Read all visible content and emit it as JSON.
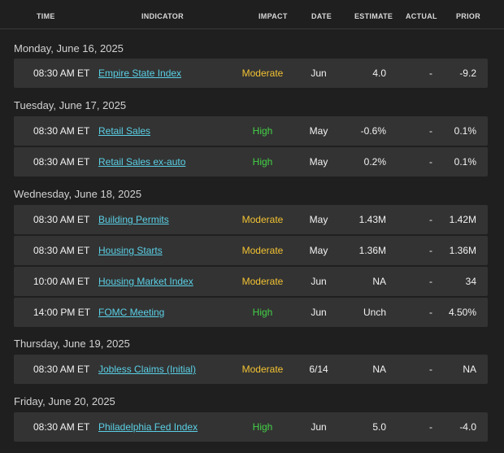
{
  "header": {
    "time": "TIME",
    "indicator": "INDICATOR",
    "impact": "IMPACT",
    "date": "DATE",
    "estimate": "ESTIMATE",
    "actual": "ACTUAL",
    "prior": "PRIOR"
  },
  "days": [
    {
      "label": "Monday, June 16, 2025",
      "rows": [
        {
          "time": "08:30 AM ET",
          "indicator": "Empire State Index",
          "impact": "Moderate",
          "date": "Jun",
          "estimate": "4.0",
          "actual": "-",
          "prior": "-9.2"
        }
      ]
    },
    {
      "label": "Tuesday, June 17, 2025",
      "rows": [
        {
          "time": "08:30 AM ET",
          "indicator": "Retail Sales",
          "impact": "High",
          "date": "May",
          "estimate": "-0.6%",
          "actual": "-",
          "prior": "0.1%"
        },
        {
          "time": "08:30 AM ET",
          "indicator": "Retail Sales ex-auto",
          "impact": "High",
          "date": "May",
          "estimate": "0.2%",
          "actual": "-",
          "prior": "0.1%"
        }
      ]
    },
    {
      "label": "Wednesday, June 18, 2025",
      "rows": [
        {
          "time": "08:30 AM ET",
          "indicator": "Building Permits",
          "impact": "Moderate",
          "date": "May",
          "estimate": "1.43M",
          "actual": "-",
          "prior": "1.42M"
        },
        {
          "time": "08:30 AM ET",
          "indicator": "Housing Starts",
          "impact": "Moderate",
          "date": "May",
          "estimate": "1.36M",
          "actual": "-",
          "prior": "1.36M"
        },
        {
          "time": "10:00 AM ET",
          "indicator": "Housing Market Index",
          "impact": "Moderate",
          "date": "Jun",
          "estimate": "NA",
          "actual": "-",
          "prior": "34"
        },
        {
          "time": "14:00 PM ET",
          "indicator": "FOMC Meeting",
          "impact": "High",
          "date": "Jun",
          "estimate": "Unch",
          "actual": "-",
          "prior": "4.50%"
        }
      ]
    },
    {
      "label": "Thursday, June 19, 2025",
      "rows": [
        {
          "time": "08:30 AM ET",
          "indicator": "Jobless Claims (Initial)",
          "impact": "Moderate",
          "date": "6/14",
          "estimate": "NA",
          "actual": "-",
          "prior": "NA"
        }
      ]
    },
    {
      "label": "Friday, June 20, 2025",
      "rows": [
        {
          "time": "08:30 AM ET",
          "indicator": "Philadelphia Fed Index",
          "impact": "High",
          "date": "Jun",
          "estimate": "5.0",
          "actual": "-",
          "prior": "-4.0"
        }
      ]
    }
  ],
  "colors": {
    "moderate": "#f2c233",
    "high": "#43d146",
    "link": "#5ad0e6"
  }
}
